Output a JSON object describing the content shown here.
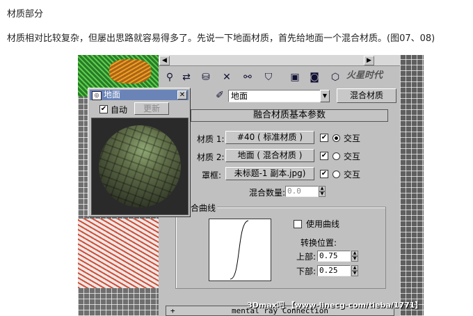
{
  "article": {
    "heading": "材质部分",
    "intro": "材质相对比较复杂，但屡出思路就容易得多了。先说一下地面材质，首先给地面一个混合材质。(图07、08)"
  },
  "preview_window": {
    "title": "地面",
    "auto_label": "自动",
    "auto_checked": true,
    "update_label": "更新"
  },
  "editor": {
    "material_name": "地面",
    "material_type_button": "混合材质",
    "rollout_title": "融合材质基本参数",
    "material1": {
      "label": "材质 1:",
      "value": "#40  ( 标准材质 )",
      "enabled": true,
      "interactive_label": "交互",
      "interactive_selected": true
    },
    "material2": {
      "label": "材质 2:",
      "value": "地面  ( 混合材质 )",
      "enabled": true,
      "interactive_label": "交互",
      "interactive_selected": false
    },
    "mask": {
      "label": "罩框:",
      "value": "未标题-1 副本.jpg)",
      "enabled": true,
      "interactive_label": "交互",
      "interactive_selected": false
    },
    "mix_amount": {
      "label": "混合数量:",
      "value": "0.0"
    },
    "mixing_curve": {
      "group_label": "合曲线",
      "use_curve_label": "使用曲线",
      "use_curve_checked": false,
      "transition_label": "转换位置:",
      "upper_label": "上部:",
      "upper_value": "0.75",
      "lower_label": "下部:",
      "lower_value": "0.25"
    },
    "bottom_rollout": {
      "toggle": "+",
      "title": "mental ray Connection"
    }
  },
  "watermark": "3Dmax吧 【www-linecg-com/tieba/1771】",
  "logo_text": "火星时代"
}
